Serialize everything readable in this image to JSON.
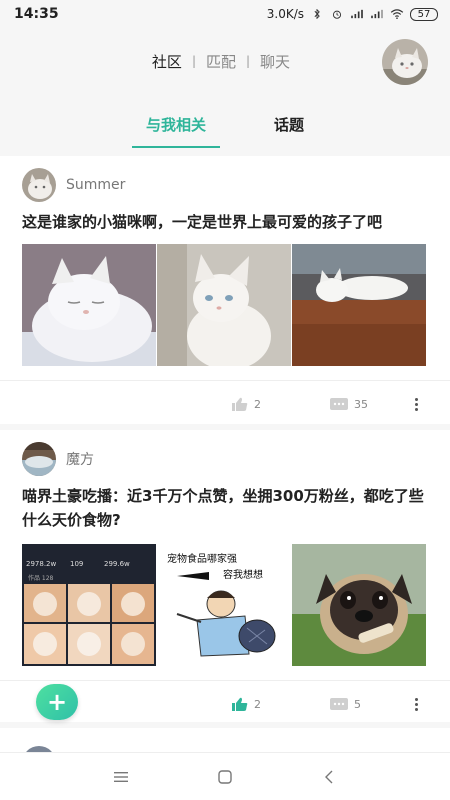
{
  "status_bar": {
    "time": "14:35",
    "speed": "3.0K/s",
    "battery": "57"
  },
  "top_nav": {
    "links": [
      "社区",
      "匹配",
      "聊天"
    ],
    "active": "社区",
    "separator": "|"
  },
  "tabs": [
    {
      "label": "与我相关",
      "active": true
    },
    {
      "label": "话题",
      "active": false
    }
  ],
  "posts": [
    {
      "author": "Summer",
      "title": "这是谁家的小猫咪啊，一定是世界上最可爱的孩子了吧",
      "likes": "2",
      "comments": "35"
    },
    {
      "author": "魔方",
      "title": "喵界土豪吃播：近3千万个点赞，坐拥300万粉丝，都吃了些什么天价食物?",
      "likes": "2",
      "comments": "5",
      "image_texts": {
        "stats": [
          "2978.2w",
          "109",
          "299.6w"
        ],
        "tab": "作品 128",
        "comic_line1": "宠物食品哪家强",
        "comic_line2": "容我想想"
      }
    }
  ],
  "fab": {
    "label": "+"
  },
  "colors": {
    "accent": "#2fb59a",
    "background": "#f6f6f6"
  }
}
